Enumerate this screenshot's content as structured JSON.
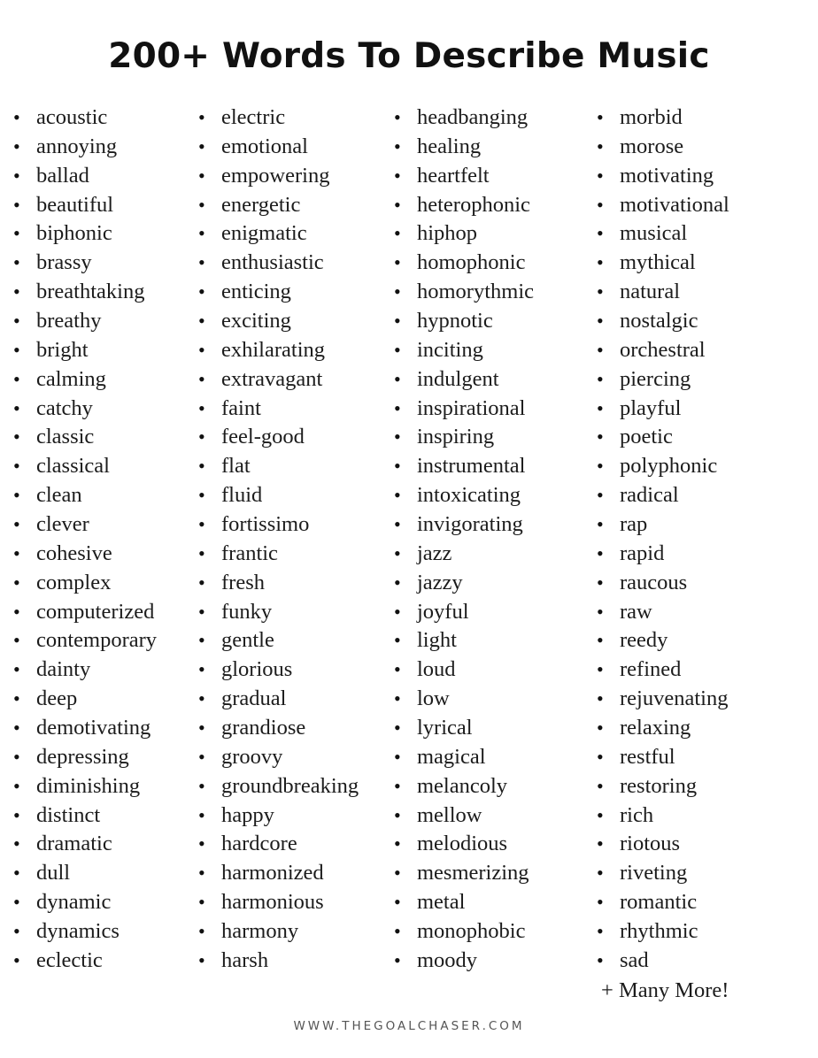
{
  "title": "200+ Words To Describe Music",
  "bullet_symbol": "•",
  "columns": [
    {
      "items": [
        "acoustic",
        "annoying",
        "ballad",
        "beautiful",
        "biphonic",
        "brassy",
        "breathtaking",
        "breathy",
        "bright",
        "calming",
        "catchy",
        "classic",
        "classical",
        "clean",
        "clever",
        "cohesive",
        "complex",
        "computerized",
        "contemporary",
        "dainty",
        "deep",
        "demotivating",
        "depressing",
        "diminishing",
        "distinct",
        "dramatic",
        "dull",
        "dynamic",
        "dynamics",
        "eclectic"
      ]
    },
    {
      "items": [
        "electric",
        "emotional",
        "empowering",
        "energetic",
        "enigmatic",
        "enthusiastic",
        "enticing",
        "exciting",
        "exhilarating",
        "extravagant",
        "faint",
        "feel-good",
        "flat",
        "fluid",
        "fortissimo",
        "frantic",
        "fresh",
        "funky",
        "gentle",
        "glorious",
        "gradual",
        "grandiose",
        "groovy",
        "groundbreaking",
        "happy",
        "hardcore",
        "harmonized",
        "harmonious",
        "harmony",
        "harsh"
      ]
    },
    {
      "items": [
        "headbanging",
        "healing",
        "heartfelt",
        "heterophonic",
        "hiphop",
        "homophonic",
        "homorythmic",
        "hypnotic",
        "inciting",
        "indulgent",
        "inspirational",
        "inspiring",
        "instrumental",
        "intoxicating",
        "invigorating",
        "jazz",
        "jazzy",
        "joyful",
        "light",
        "loud",
        "low",
        "lyrical",
        "magical",
        "melancoly",
        "mellow",
        "melodious",
        "mesmerizing",
        "metal",
        "monophobic",
        "moody"
      ]
    },
    {
      "items": [
        "morbid",
        "morose",
        "motivating",
        "motivational",
        "musical",
        "mythical",
        "natural",
        "nostalgic",
        "orchestral",
        "piercing",
        "playful",
        "poetic",
        "polyphonic",
        "radical",
        "rap",
        "rapid",
        "raucous",
        "raw",
        "reedy",
        "refined",
        "rejuvenating",
        "relaxing",
        "restful",
        "restoring",
        "rich",
        "riotous",
        "riveting",
        "romantic",
        "rhythmic",
        "sad"
      ]
    }
  ],
  "more_label": "+ Many More!",
  "footer": "WWW.THEGOALCHASER.COM"
}
